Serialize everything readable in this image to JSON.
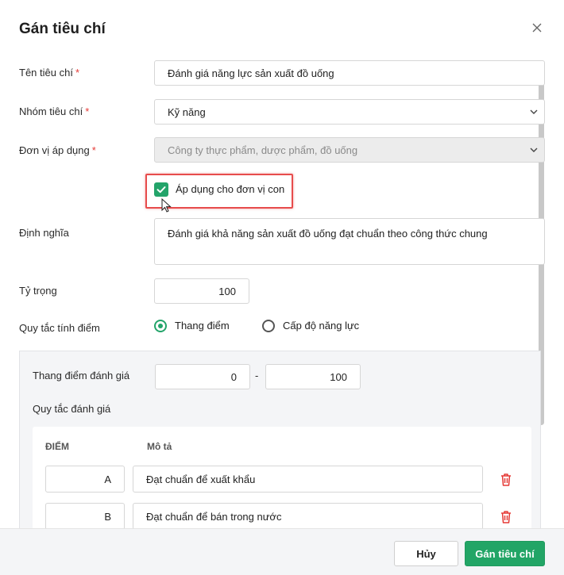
{
  "dialog": {
    "title": "Gán tiêu chí",
    "close_icon": "close-icon"
  },
  "form": {
    "name": {
      "label": "Tên tiêu chí",
      "required": "*",
      "value": "Đánh giá năng lực sản xuất đồ uống"
    },
    "group": {
      "label": "Nhóm tiêu chí",
      "required": "*",
      "value": "Kỹ năng"
    },
    "unit": {
      "label": "Đơn vị áp dụng",
      "required": "*",
      "value": "Công ty thực phẩm, dược phẩm, đồ uống"
    },
    "apply_child": {
      "label": "Áp dụng cho đơn vị con",
      "checked": true
    },
    "definition": {
      "label": "Định nghĩa",
      "value": "Đánh giá khả năng sản xuất đồ uống đạt chuẩn theo công thức chung"
    },
    "weight": {
      "label": "Tỷ trọng",
      "value": "100"
    },
    "scoring_rule": {
      "label": "Quy tắc tính điểm",
      "options": [
        {
          "label": "Thang điểm",
          "selected": true
        },
        {
          "label": "Cấp độ năng lực",
          "selected": false
        }
      ]
    }
  },
  "scale": {
    "label": "Thang điểm đánh giá",
    "min": "0",
    "separator": "-",
    "max": "100",
    "rules_label": "Quy tắc đánh giá",
    "columns": [
      "ĐIỂM",
      "Mô tả"
    ],
    "rows": [
      {
        "grade": "A",
        "description": "Đạt chuẩn để xuất khẩu"
      },
      {
        "grade": "B",
        "description": "Đạt chuẩn để bán trong nước"
      }
    ]
  },
  "footer": {
    "cancel_label": "Hủy",
    "submit_label": "Gán tiêu chí"
  },
  "colors": {
    "accent": "#22a566",
    "required": "#e53935",
    "delete": "#e53935",
    "highlight": "#e74c4c"
  }
}
